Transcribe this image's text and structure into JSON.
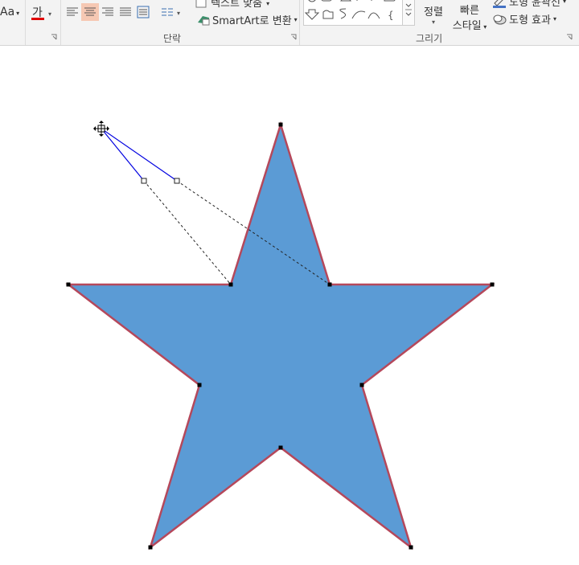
{
  "ribbon": {
    "font": {
      "size_label": "Aa",
      "color_label": "가",
      "color_bar": "#e00000"
    },
    "paragraph": {
      "group_label": "단락",
      "align_buttons": [
        "align-left",
        "align-center",
        "align-right",
        "justify",
        "distribute"
      ],
      "active_align": "align-center",
      "text_fit_label": "텍스트 맞춤",
      "smartart_label": "SmartArt로 변환"
    },
    "drawing": {
      "group_label": "그리기",
      "arrange_label": "정렬",
      "quick_styles_label_line1": "빠른",
      "quick_styles_label_line2": "스타일",
      "shape_outline_label": "도형 윤곽선",
      "shape_effects_label": "도형 효과"
    }
  },
  "shape": {
    "type": "star-5",
    "fill_color": "#5b9bd5",
    "outline_color": "#b5485b",
    "handle_line_color": "#0000e0"
  }
}
